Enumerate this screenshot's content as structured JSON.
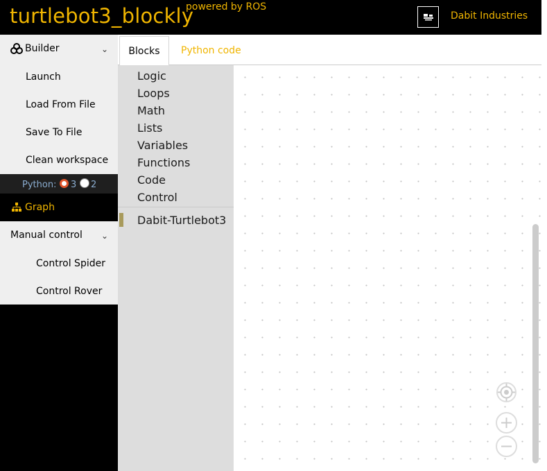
{
  "header": {
    "title": "turtlebot3_blockly",
    "powered_by": "powered by ROS",
    "company": "Dabit Industries",
    "logo_icon": "dabit-logo-icon",
    "accent_color": "#f0b500"
  },
  "sidebar": {
    "builder": {
      "label": "Builder",
      "icon": "cubes-icon",
      "items": [
        "Launch",
        "Load From File",
        "Save To File",
        "Clean workspace"
      ]
    },
    "python": {
      "label": "Python:",
      "option_3": "3",
      "option_2": "2",
      "selected": "3"
    },
    "graph": {
      "label": "Graph",
      "icon": "sitemap-icon"
    },
    "manual": {
      "label": "Manual control",
      "items": [
        "Control Spider",
        "Control Rover"
      ]
    }
  },
  "tabs": [
    {
      "label": "Blocks",
      "active": true
    },
    {
      "label": "Python code",
      "active": false
    }
  ],
  "toolbox": {
    "categories": [
      "Logic",
      "Loops",
      "Math",
      "Lists",
      "Variables",
      "Functions",
      "Code",
      "Control"
    ],
    "custom_category": "Dabit-Turtlebot3"
  },
  "workspace": {
    "controls": [
      "recenter-icon",
      "zoom-in-icon",
      "zoom-out-icon"
    ]
  }
}
